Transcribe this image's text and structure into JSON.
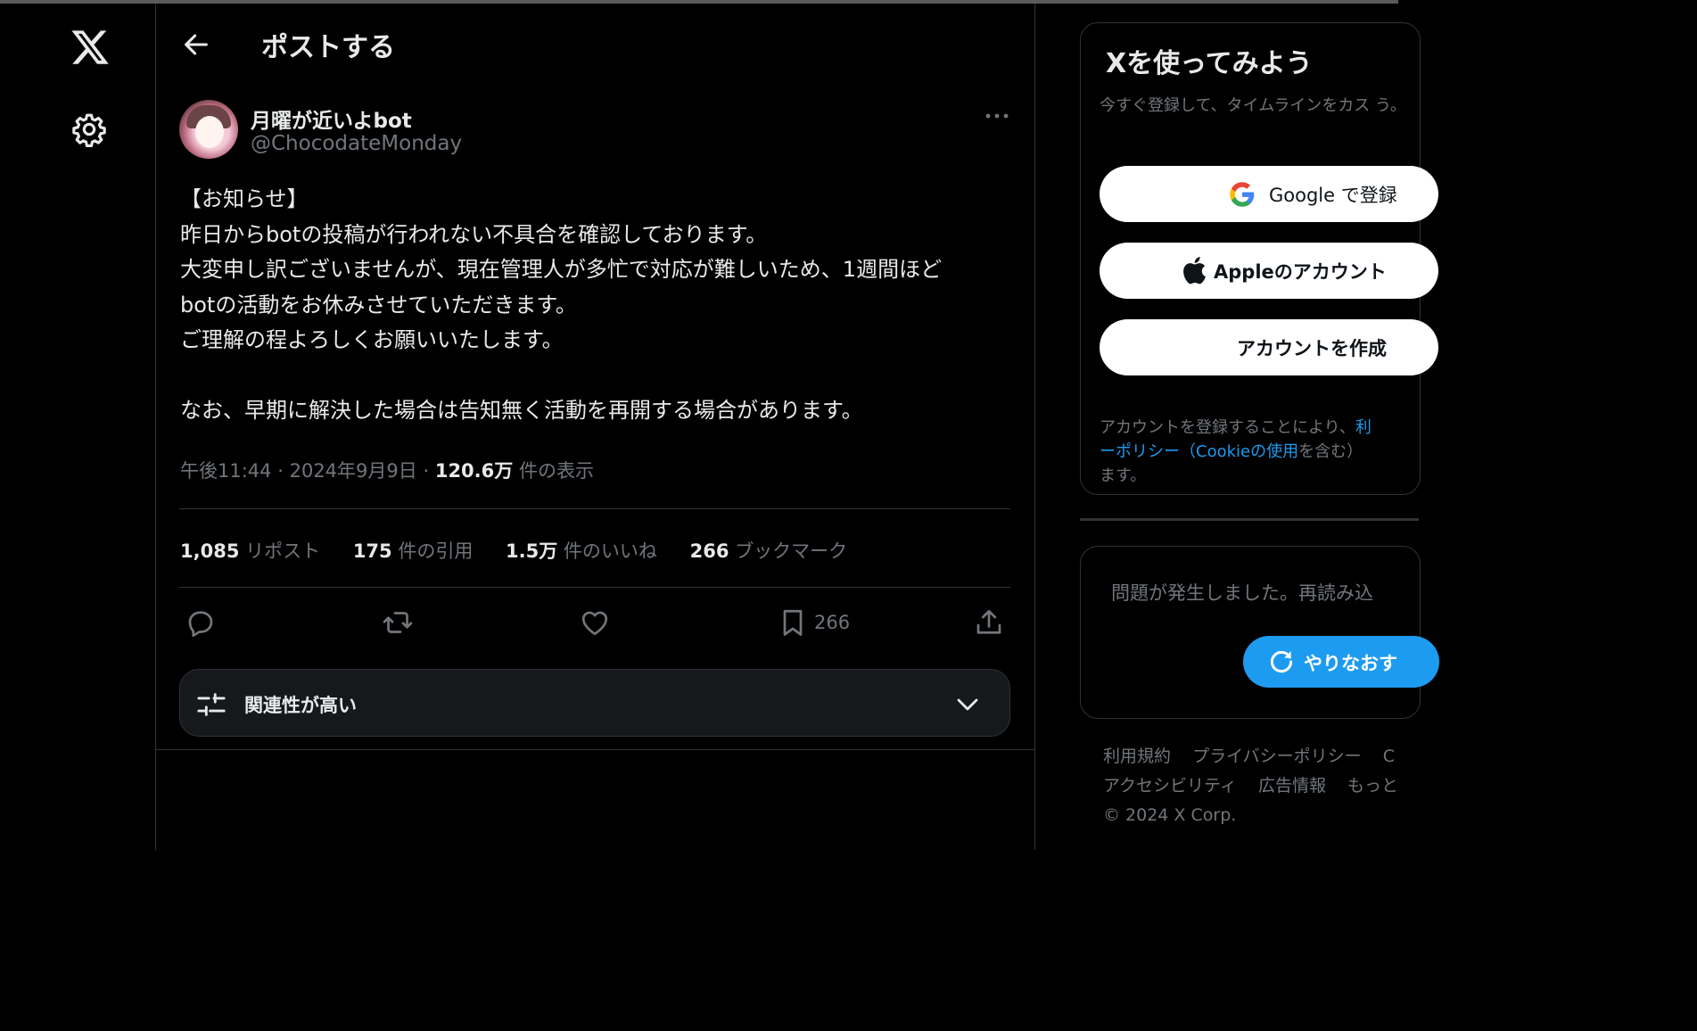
{
  "header": {
    "title": "ポストする"
  },
  "tweet": {
    "author_name": "月曜が近いよbot",
    "author_handle": "@ChocodateMonday",
    "lines": [
      "【お知らせ】",
      "昨日からbotの投稿が行われない不具合を確認しております。",
      "大変申し訳ございませんが、現在管理人が多忙で対応が難しいため、1週間ほど",
      "botの活動をお休みさせていただきます。",
      "ご理解の程よろしくお願いいたします。",
      "",
      "なお、早期に解決した場合は告知無く活動を再開する場合があります。"
    ],
    "time": "午後11:44",
    "date": "2024年9月9日",
    "views": "120.6万",
    "views_label": "件の表示",
    "separator": "·"
  },
  "stats": [
    {
      "value": "1,085",
      "label": "リポスト"
    },
    {
      "value": "175",
      "label": "件の引用"
    },
    {
      "value": "1.5万",
      "label": "件のいいね"
    },
    {
      "value": "266",
      "label": "ブックマーク"
    }
  ],
  "actions": {
    "bookmark_count": "266",
    "icons": [
      "reply-icon",
      "retweet-icon",
      "like-icon",
      "bookmark-icon",
      "share-icon"
    ]
  },
  "sort": {
    "label": "関連性が高い"
  },
  "signup": {
    "title": "Xを使ってみよう",
    "description": "今すぐ登録して、タイムラインをカス う。",
    "google_label": "Google で登録",
    "apple_label": "Appleのアカウント",
    "create_label": "アカウントを作成",
    "legal_prefix": "アカウントを登録することにより、",
    "legal_link1": "利",
    "legal_link2": "ーポリシー（Cookieの使用",
    "legal_mid": "を含む）",
    "legal_suffix": "ます。"
  },
  "error_card": {
    "message": "問題が発生しました。再読み込",
    "retry_label": "やりなおす"
  },
  "footer": {
    "links_row1": [
      "利用規約",
      "プライバシーポリシー",
      "C"
    ],
    "links_row2": [
      "アクセシビリティ",
      "広告情報",
      "もっと"
    ],
    "copyright": "© 2024 X Corp."
  },
  "colors": {
    "background": "#000000",
    "text_primary": "#e7e9ea",
    "text_secondary": "#71767b",
    "border": "#2f3336",
    "accent": "#1d9bf0"
  }
}
